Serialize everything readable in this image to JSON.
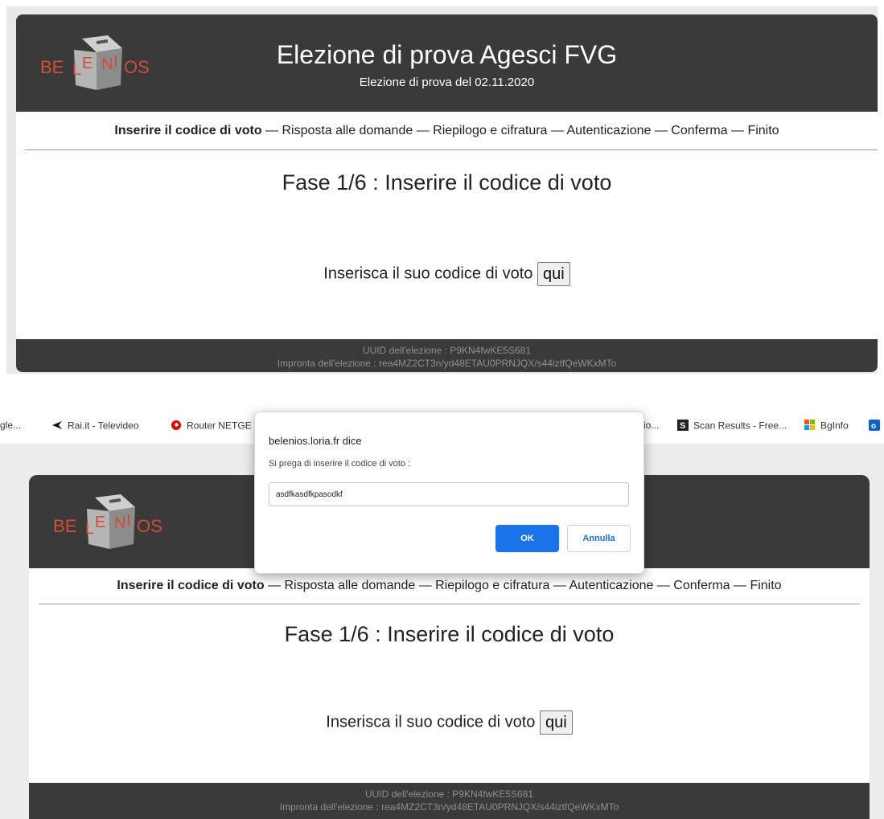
{
  "election": {
    "title": "Elezione di prova Agesci FVG",
    "subtitle": "Elezione di prova del 02.11.2020"
  },
  "logo": {
    "left": "BE",
    "mid1": "L",
    "mid2": "E",
    "mid3": "N",
    "mid4": "I",
    "right": "OS"
  },
  "steps": {
    "current": "Inserire il codice di voto",
    "rest": " — Risposta alle domande — Riepilogo e cifratura — Autenticazione — Conferma — Finito"
  },
  "phase_title": "Fase 1/6 : Inserire il codice di voto",
  "prompt_text": "Inserisca il suo codice di voto",
  "prompt_button": "qui",
  "footer": {
    "uuid": "UUID dell'elezione : P9KN4fwKE5S681",
    "fingerprint": "Impronta dell'elezione : rea4MZ2CT3n/yd48ETAU0PRNJQX/s44iztfQeWKxMTo"
  },
  "bookmarks": {
    "item1": "gle...",
    "item2": "Rai.it - Televideo",
    "item3": "Router NETGE",
    "item4": "io...",
    "item5": "Scan Results - Free...",
    "item6": "BgInfo"
  },
  "dialog": {
    "title": "belenios.loria.fr dice",
    "message": "Si prega di inserire il codice di voto :",
    "input_value": "asdfkasdfkpasodkf",
    "ok_label": "OK",
    "cancel_label": "Annulla"
  },
  "colors": {
    "header_bg": "#3a3a3a",
    "logo_red": "#d04d38",
    "dialog_ok": "#1a73e8"
  }
}
